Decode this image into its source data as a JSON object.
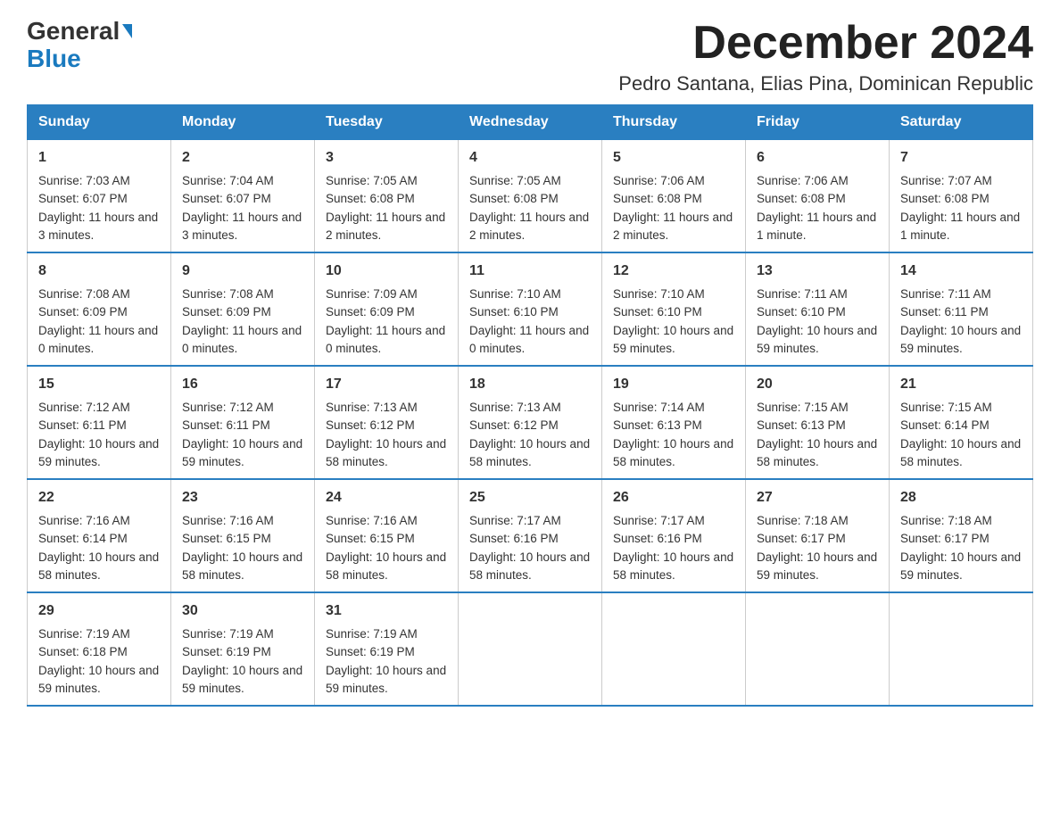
{
  "logo": {
    "general": "General",
    "triangle": "",
    "blue": "Blue"
  },
  "title": "December 2024",
  "subtitle": "Pedro Santana, Elias Pina, Dominican Republic",
  "days": [
    "Sunday",
    "Monday",
    "Tuesday",
    "Wednesday",
    "Thursday",
    "Friday",
    "Saturday"
  ],
  "weeks": [
    [
      {
        "day": "1",
        "sunrise": "7:03 AM",
        "sunset": "6:07 PM",
        "daylight": "11 hours and 3 minutes."
      },
      {
        "day": "2",
        "sunrise": "7:04 AM",
        "sunset": "6:07 PM",
        "daylight": "11 hours and 3 minutes."
      },
      {
        "day": "3",
        "sunrise": "7:05 AM",
        "sunset": "6:08 PM",
        "daylight": "11 hours and 2 minutes."
      },
      {
        "day": "4",
        "sunrise": "7:05 AM",
        "sunset": "6:08 PM",
        "daylight": "11 hours and 2 minutes."
      },
      {
        "day": "5",
        "sunrise": "7:06 AM",
        "sunset": "6:08 PM",
        "daylight": "11 hours and 2 minutes."
      },
      {
        "day": "6",
        "sunrise": "7:06 AM",
        "sunset": "6:08 PM",
        "daylight": "11 hours and 1 minute."
      },
      {
        "day": "7",
        "sunrise": "7:07 AM",
        "sunset": "6:08 PM",
        "daylight": "11 hours and 1 minute."
      }
    ],
    [
      {
        "day": "8",
        "sunrise": "7:08 AM",
        "sunset": "6:09 PM",
        "daylight": "11 hours and 0 minutes."
      },
      {
        "day": "9",
        "sunrise": "7:08 AM",
        "sunset": "6:09 PM",
        "daylight": "11 hours and 0 minutes."
      },
      {
        "day": "10",
        "sunrise": "7:09 AM",
        "sunset": "6:09 PM",
        "daylight": "11 hours and 0 minutes."
      },
      {
        "day": "11",
        "sunrise": "7:10 AM",
        "sunset": "6:10 PM",
        "daylight": "11 hours and 0 minutes."
      },
      {
        "day": "12",
        "sunrise": "7:10 AM",
        "sunset": "6:10 PM",
        "daylight": "10 hours and 59 minutes."
      },
      {
        "day": "13",
        "sunrise": "7:11 AM",
        "sunset": "6:10 PM",
        "daylight": "10 hours and 59 minutes."
      },
      {
        "day": "14",
        "sunrise": "7:11 AM",
        "sunset": "6:11 PM",
        "daylight": "10 hours and 59 minutes."
      }
    ],
    [
      {
        "day": "15",
        "sunrise": "7:12 AM",
        "sunset": "6:11 PM",
        "daylight": "10 hours and 59 minutes."
      },
      {
        "day": "16",
        "sunrise": "7:12 AM",
        "sunset": "6:11 PM",
        "daylight": "10 hours and 59 minutes."
      },
      {
        "day": "17",
        "sunrise": "7:13 AM",
        "sunset": "6:12 PM",
        "daylight": "10 hours and 58 minutes."
      },
      {
        "day": "18",
        "sunrise": "7:13 AM",
        "sunset": "6:12 PM",
        "daylight": "10 hours and 58 minutes."
      },
      {
        "day": "19",
        "sunrise": "7:14 AM",
        "sunset": "6:13 PM",
        "daylight": "10 hours and 58 minutes."
      },
      {
        "day": "20",
        "sunrise": "7:15 AM",
        "sunset": "6:13 PM",
        "daylight": "10 hours and 58 minutes."
      },
      {
        "day": "21",
        "sunrise": "7:15 AM",
        "sunset": "6:14 PM",
        "daylight": "10 hours and 58 minutes."
      }
    ],
    [
      {
        "day": "22",
        "sunrise": "7:16 AM",
        "sunset": "6:14 PM",
        "daylight": "10 hours and 58 minutes."
      },
      {
        "day": "23",
        "sunrise": "7:16 AM",
        "sunset": "6:15 PM",
        "daylight": "10 hours and 58 minutes."
      },
      {
        "day": "24",
        "sunrise": "7:16 AM",
        "sunset": "6:15 PM",
        "daylight": "10 hours and 58 minutes."
      },
      {
        "day": "25",
        "sunrise": "7:17 AM",
        "sunset": "6:16 PM",
        "daylight": "10 hours and 58 minutes."
      },
      {
        "day": "26",
        "sunrise": "7:17 AM",
        "sunset": "6:16 PM",
        "daylight": "10 hours and 58 minutes."
      },
      {
        "day": "27",
        "sunrise": "7:18 AM",
        "sunset": "6:17 PM",
        "daylight": "10 hours and 59 minutes."
      },
      {
        "day": "28",
        "sunrise": "7:18 AM",
        "sunset": "6:17 PM",
        "daylight": "10 hours and 59 minutes."
      }
    ],
    [
      {
        "day": "29",
        "sunrise": "7:19 AM",
        "sunset": "6:18 PM",
        "daylight": "10 hours and 59 minutes."
      },
      {
        "day": "30",
        "sunrise": "7:19 AM",
        "sunset": "6:19 PM",
        "daylight": "10 hours and 59 minutes."
      },
      {
        "day": "31",
        "sunrise": "7:19 AM",
        "sunset": "6:19 PM",
        "daylight": "10 hours and 59 minutes."
      },
      null,
      null,
      null,
      null
    ]
  ]
}
